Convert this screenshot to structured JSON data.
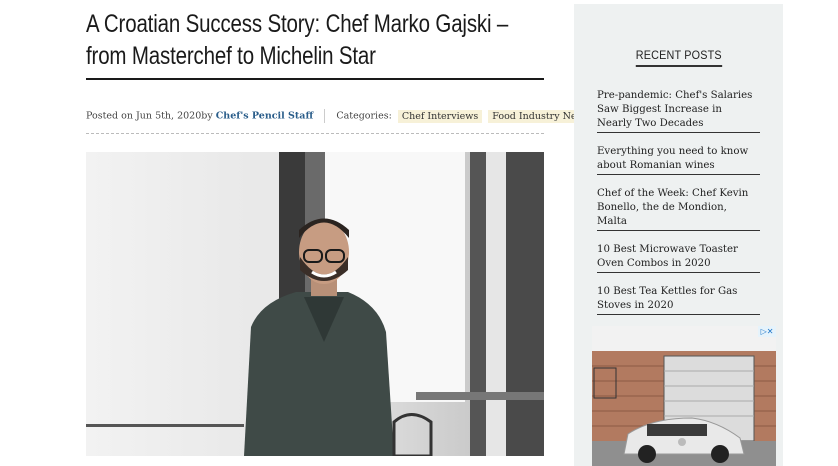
{
  "article": {
    "title": "A Croatian Success Story: Chef Marko Gajski – from Masterchef to Michelin Star",
    "meta": {
      "posted_prefix": "Posted on Jun 5th, 2020by",
      "author": "Chef's Pencil Staff",
      "categories_label": "Categories:",
      "categories": [
        "Chef Interviews",
        "Food Industry News"
      ]
    }
  },
  "sidebar": {
    "heading": "RECENT POSTS",
    "posts": [
      "Pre-pandemic: Chef's Salaries Saw Biggest Increase in Nearly Two Decades",
      "Everything you need to know about Romanian wines",
      "Chef of the Week: Chef Kevin Bonello, the de Mondion, Malta",
      "10 Best Microwave Toaster Oven Combos in 2020",
      "10 Best Tea Kettles for Gas Stoves in 2020"
    ],
    "ad_badge": "▷✕"
  },
  "colors": {
    "accent": "#2a5d8a",
    "tag_bg": "#f7f1d8",
    "sidebar_bg": "#eef1f1"
  }
}
